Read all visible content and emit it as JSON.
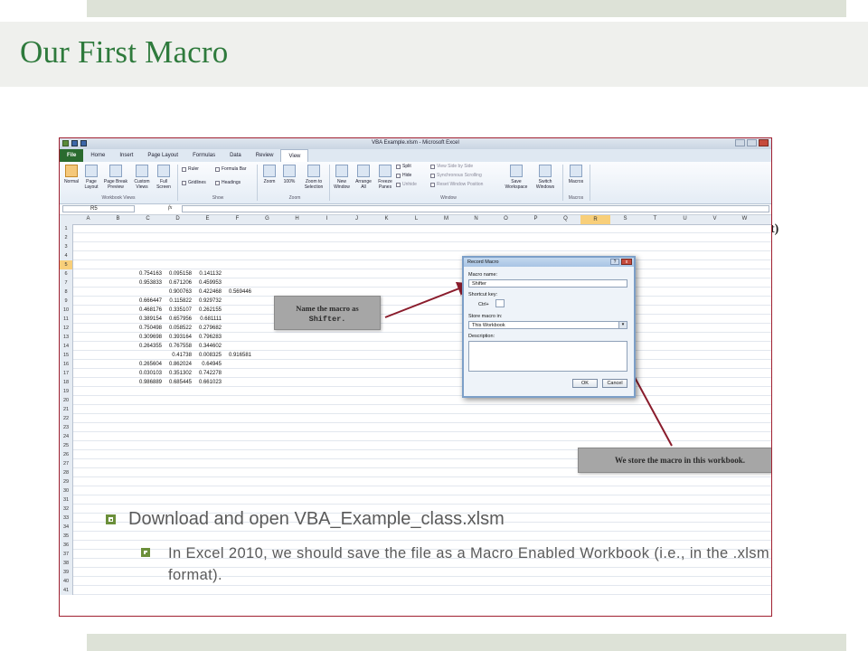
{
  "slide": {
    "title": "Our First Macro"
  },
  "excel": {
    "window_title": "VBA Example.xlsm - Microsoft Excel",
    "tabs": [
      "File",
      "Home",
      "Insert",
      "Page Layout",
      "Formulas",
      "Data",
      "Review",
      "View"
    ],
    "active_tab": "View",
    "ribbon": {
      "normal": "Normal",
      "page_layout": "Page Layout",
      "page_break_preview": "Page Break Preview",
      "custom_views": "Custom Views",
      "full_screen": "Full Screen",
      "workbook_views": "Workbook Views",
      "ruler": "Ruler",
      "formula_bar": "Formula Bar",
      "gridlines": "Gridlines",
      "headings": "Headings",
      "show": "Show",
      "zoom": "Zoom",
      "zoom_100": "100%",
      "zoom_to_selection": "Zoom to Selection",
      "zoom_group": "Zoom",
      "new_window": "New Window",
      "arrange_all": "Arrange All",
      "freeze_panes": "Freeze Panes",
      "split": "Split",
      "hide": "Hide",
      "unhide": "Unhide",
      "view_side_by_side": "View Side by Side",
      "synchronous_scrolling": "Synchronous Scrolling",
      "reset_window_position": "Reset Window Position",
      "save_workspace": "Save Workspace",
      "switch_windows": "Switch Windows",
      "window_group": "Window",
      "macros": "Macros",
      "macros_group": "Macros"
    },
    "name_box": "R5",
    "fx": "fx",
    "columns": [
      "A",
      "B",
      "C",
      "D",
      "E",
      "F",
      "G",
      "H",
      "I",
      "J",
      "K",
      "L",
      "M",
      "N",
      "O",
      "P",
      "Q",
      "R",
      "S",
      "T",
      "U",
      "V",
      "W"
    ],
    "selected_column": "R",
    "selected_row": "5",
    "row_numbers": [
      "1",
      "2",
      "3",
      "4",
      "5",
      "6",
      "7",
      "8",
      "9",
      "10",
      "11",
      "12",
      "13",
      "14",
      "15",
      "16",
      "17",
      "18",
      "19",
      "20",
      "21",
      "22",
      "23",
      "24",
      "25",
      "26",
      "27",
      "28",
      "29",
      "30",
      "31",
      "32",
      "33",
      "34",
      "35",
      "36",
      "37",
      "38",
      "39",
      "40",
      "41"
    ],
    "cells": [
      {
        "row": 6,
        "c": "0.754163",
        "d": "0.095158",
        "e": "0.141132",
        "f": ""
      },
      {
        "row": 7,
        "c": "0.953833",
        "d": "0.671206",
        "e": "0.459953",
        "f": ""
      },
      {
        "row": 8,
        "c": "",
        "d": "0.900763",
        "e": "0.422468",
        "f": "0.569446"
      },
      {
        "row": 9,
        "c": "0.666447",
        "d": "0.115822",
        "e": "0.929732",
        "f": ""
      },
      {
        "row": 10,
        "c": "0.468176",
        "d": "0.335107",
        "e": "0.262155",
        "f": ""
      },
      {
        "row": 11,
        "c": "0.389154",
        "d": "0.657956",
        "e": "0.681111",
        "f": ""
      },
      {
        "row": 12,
        "c": "0.750498",
        "d": "0.058522",
        "e": "0.279682",
        "f": ""
      },
      {
        "row": 13,
        "c": "0.309698",
        "d": "0.393164",
        "e": "0.796283",
        "f": ""
      },
      {
        "row": 14,
        "c": "0.264355",
        "d": "0.767558",
        "e": "0.344602",
        "f": ""
      },
      {
        "row": 15,
        "c": "",
        "d": "0.41738",
        "e": "0.008325",
        "f": "0.916581"
      },
      {
        "row": 16,
        "c": "0.265604",
        "d": "0.862024",
        "e": "0.64945",
        "f": ""
      },
      {
        "row": 17,
        "c": "0.030103",
        "d": "0.351302",
        "e": "0.742278",
        "f": ""
      },
      {
        "row": 18,
        "c": "0.986889",
        "d": "0.685445",
        "e": "0.661023",
        "f": ""
      }
    ],
    "dialog": {
      "title": "Record Macro",
      "help": "?",
      "close": "x",
      "macro_name_label": "Macro name:",
      "macro_name_value": "Shifter",
      "shortcut_label": "Shortcut key:",
      "ctrl_label": "Ctrl+",
      "store_label": "Store macro in:",
      "store_value": "This Workbook",
      "description_label": "Description:",
      "ok": "OK",
      "cancel": "Cancel"
    },
    "callout_name_line1": "Name the macro as",
    "callout_name_line2": "Shifter.",
    "callout_store": "We store the macro in this workbook."
  },
  "cut_text": "at)",
  "bullets": {
    "main": "Download and open VBA_Example_class.xlsm",
    "sub": "In Excel 2010, we should save the file as a Macro Enabled Workbook (i.e., in the .xlsm format)."
  },
  "colors": {
    "title": "#2e7a3c",
    "bullet": "#6b8f3a",
    "frame": "#a02030",
    "arrow": "#8a1c2c"
  }
}
